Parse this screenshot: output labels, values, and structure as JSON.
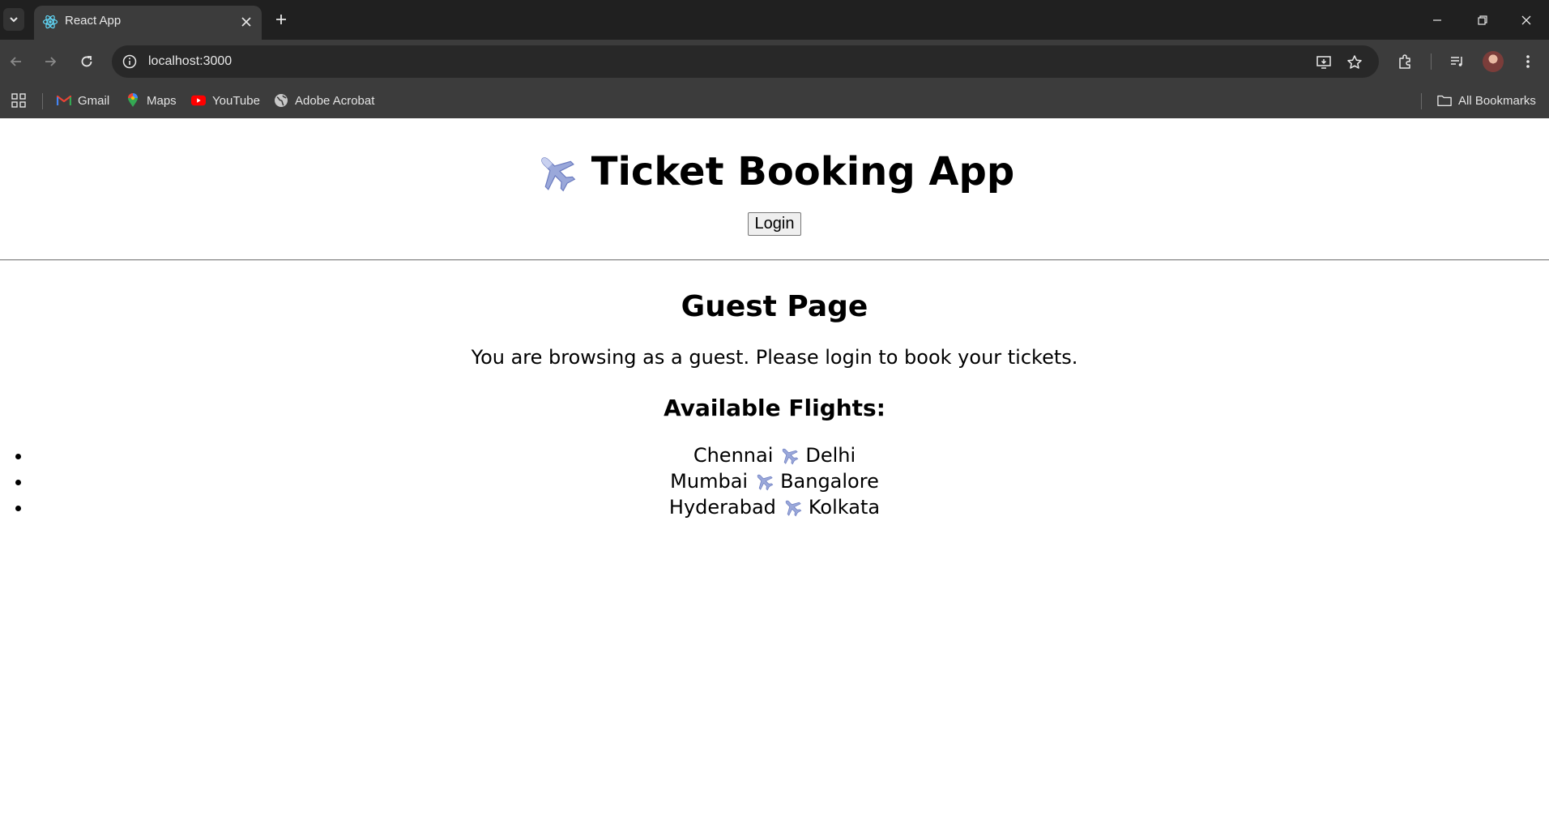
{
  "browser": {
    "tab": {
      "title": "React App",
      "favicon": "react-atom-icon"
    },
    "address_bar": {
      "url": "localhost:3000"
    },
    "bookmarks": [
      {
        "label": "Gmail",
        "icon": "gmail-icon"
      },
      {
        "label": "Maps",
        "icon": "maps-pin-icon"
      },
      {
        "label": "YouTube",
        "icon": "youtube-icon"
      },
      {
        "label": "Adobe Acrobat",
        "icon": "globe-icon"
      }
    ],
    "all_bookmarks_label": "All Bookmarks",
    "colors": {
      "tabstrip": "#202020",
      "toolbar": "#3c3c3c",
      "omnibox": "#282828"
    }
  },
  "app": {
    "title": "Ticket Booking App",
    "title_icon": "airplane-icon",
    "login_label": "Login"
  },
  "guest": {
    "heading": "Guest Page",
    "message": "You are browsing as a guest. Please login to book your tickets.",
    "flights_heading": "Available Flights:",
    "flights": [
      {
        "from": "Chennai",
        "to": "Delhi"
      },
      {
        "from": "Mumbai",
        "to": "Bangalore"
      },
      {
        "from": "Hyderabad",
        "to": "Kolkata"
      }
    ]
  }
}
